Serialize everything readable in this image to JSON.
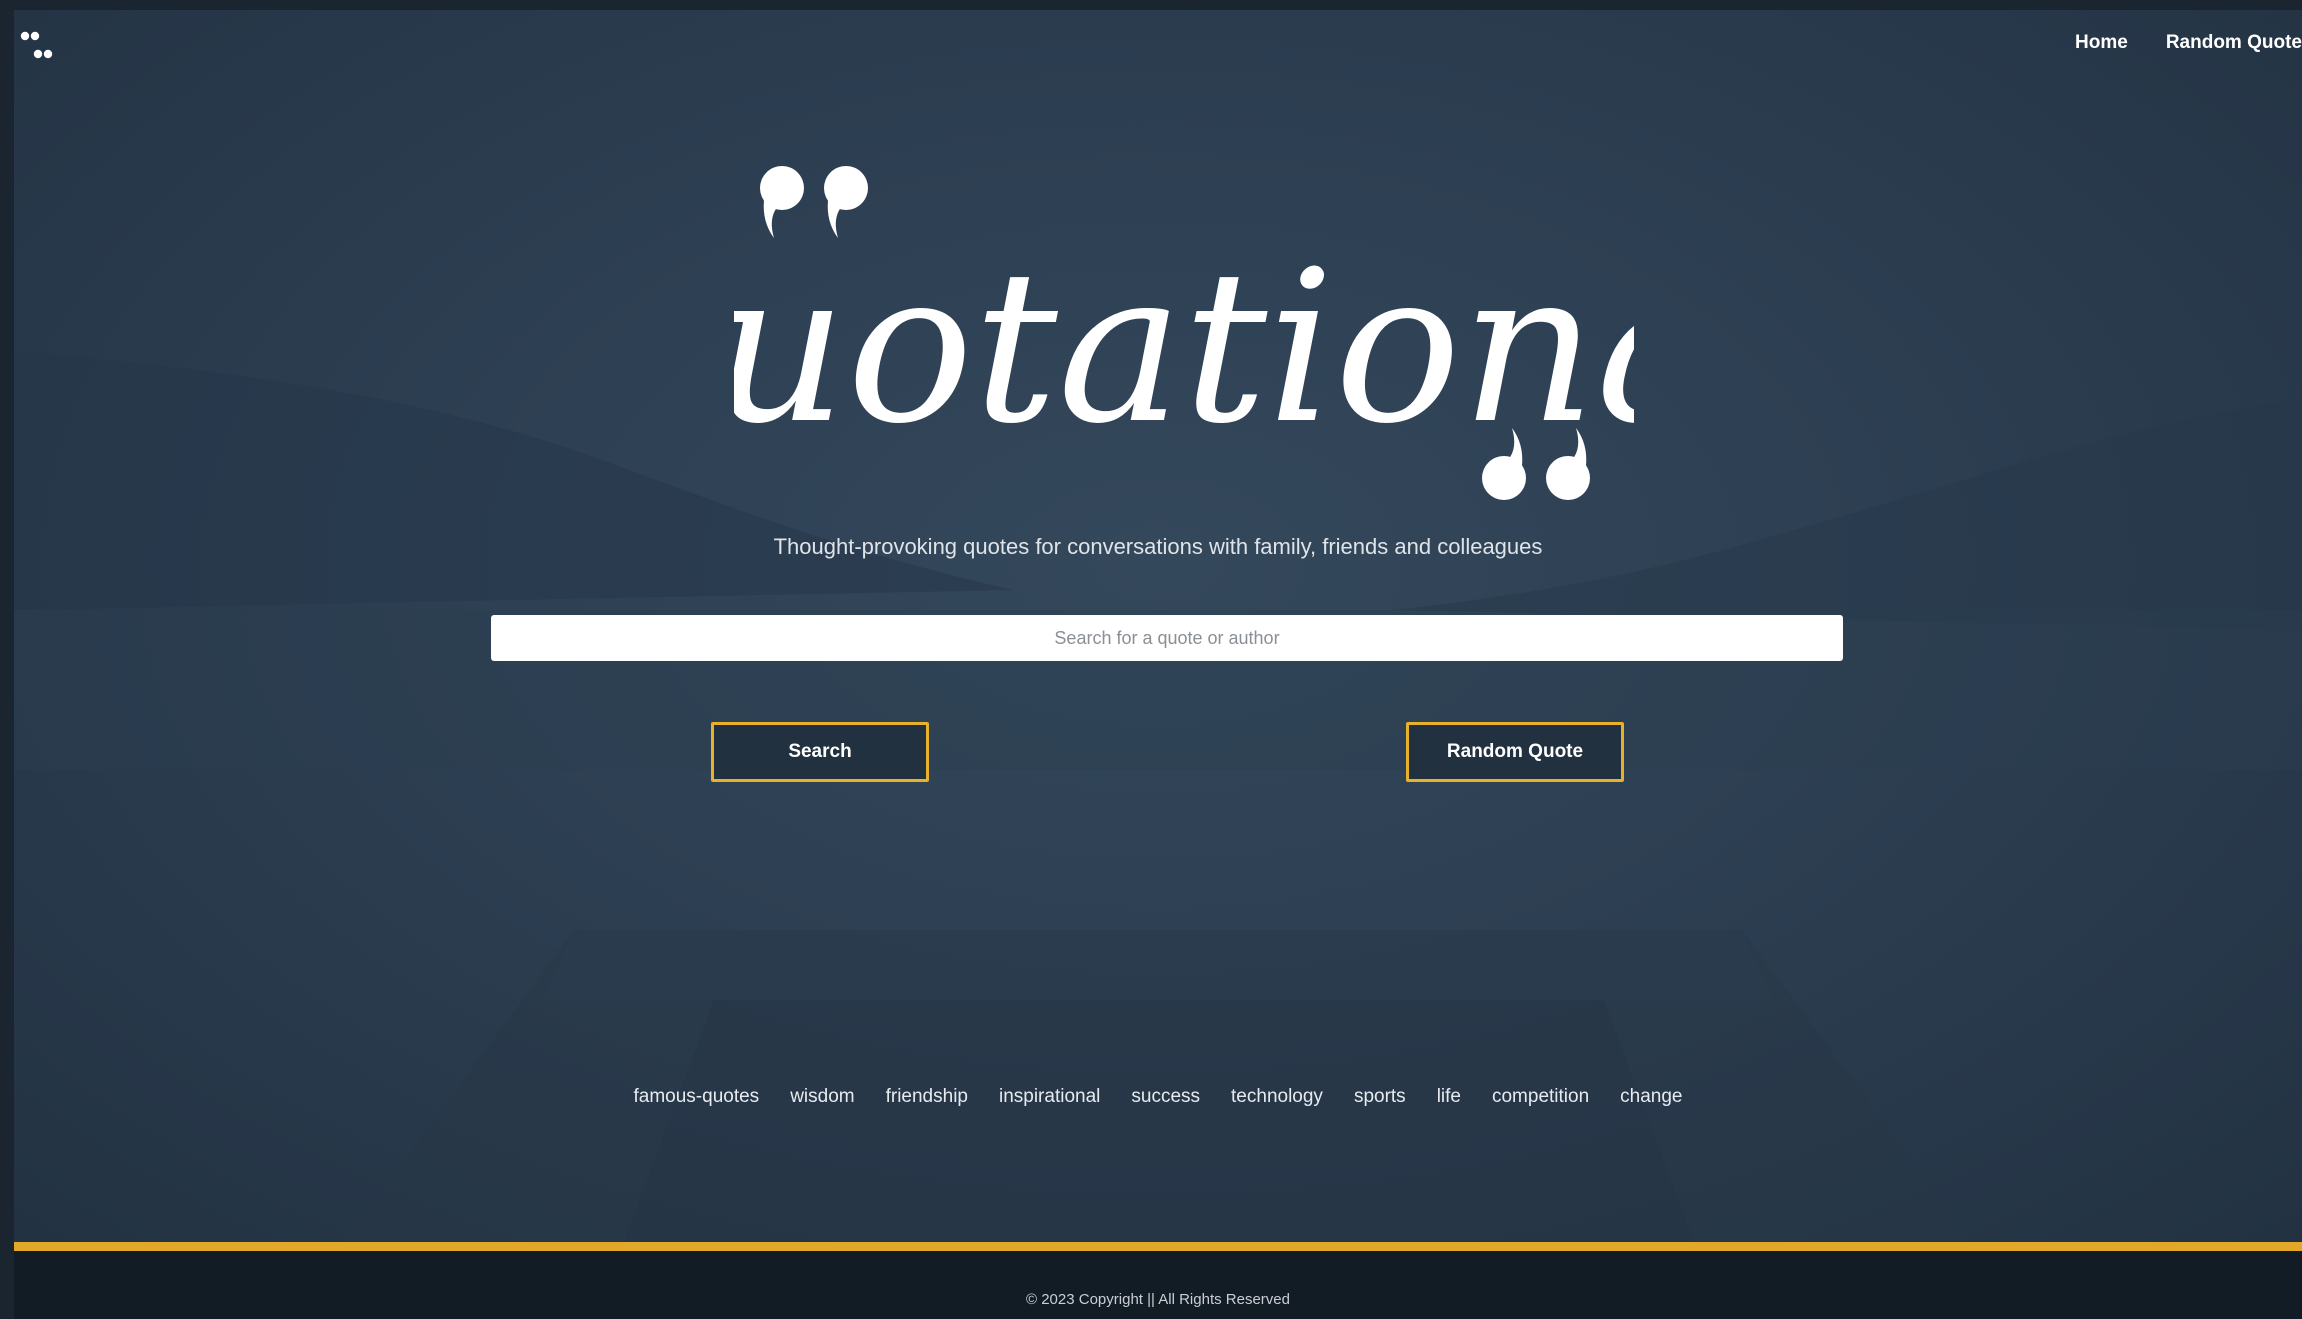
{
  "brand": {
    "logo_icon": "double-quote-dots-icon",
    "wordmark": "Quotational"
  },
  "nav": {
    "home_label": "Home",
    "random_quote_label": "Random Quote"
  },
  "hero": {
    "tagline": "Thought-provoking quotes for conversations with family, friends and colleagues"
  },
  "search": {
    "placeholder": "Search for a quote or author",
    "value": ""
  },
  "actions": {
    "search_label": "Search",
    "random_quote_label": "Random Quote"
  },
  "tags": [
    "famous-quotes",
    "wisdom",
    "friendship",
    "inspirational",
    "success",
    "technology",
    "sports",
    "life",
    "competition",
    "change"
  ],
  "footer": {
    "copyright": "© 2023 Copyright || All Rights Reserved"
  },
  "colors": {
    "accent": "#e3a82a",
    "background": "#2e4053",
    "footer": "#121c25"
  }
}
